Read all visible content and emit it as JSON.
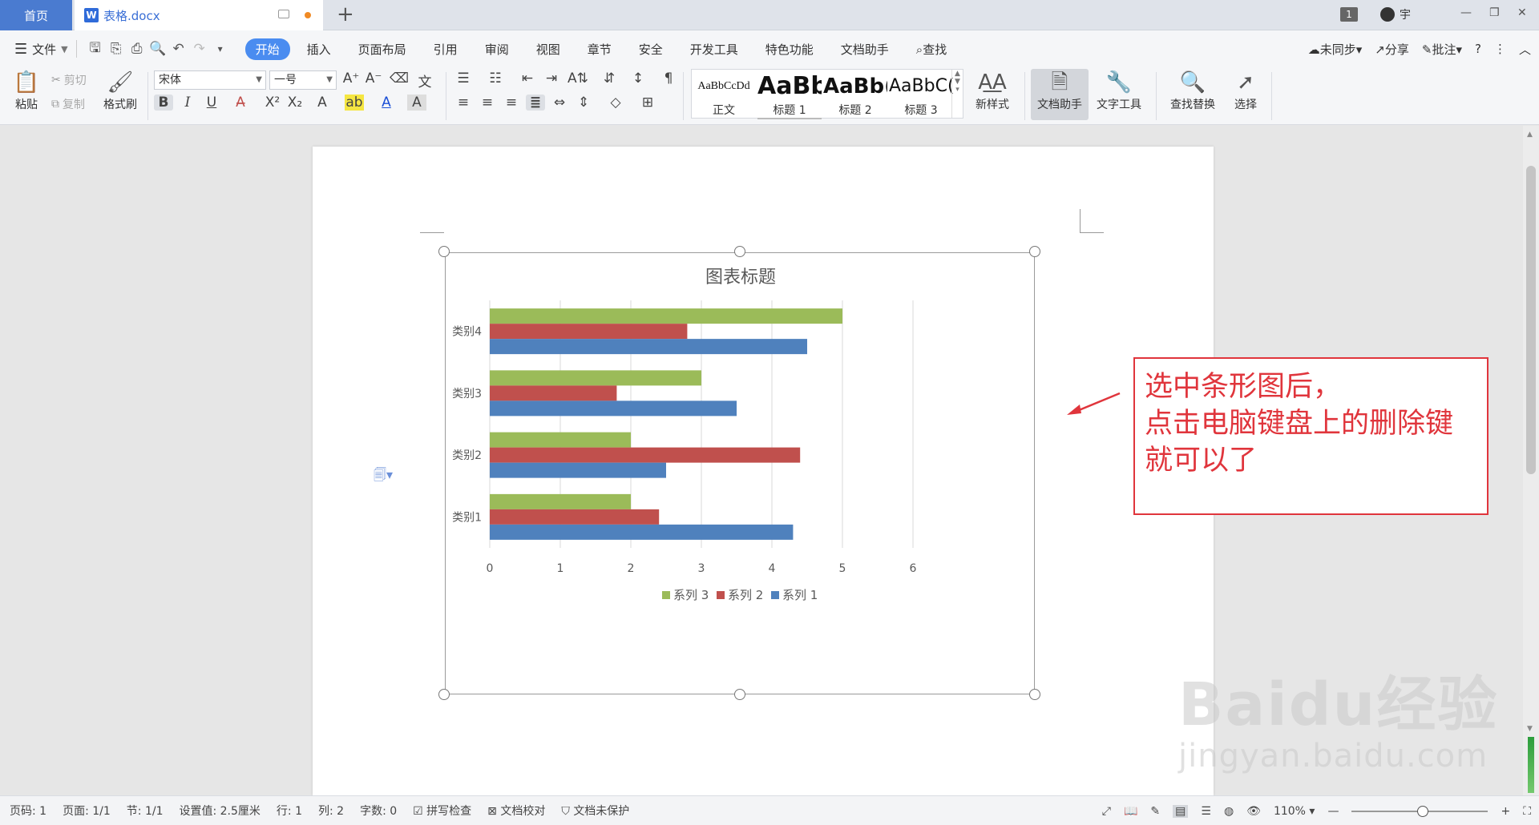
{
  "tabs": {
    "home": "首页",
    "doc_icon": "W",
    "doc_title": "表格.docx",
    "add": "+",
    "badge": "1",
    "user": "宇"
  },
  "menu": {
    "file": "文件",
    "tabs": [
      "开始",
      "插入",
      "页面布局",
      "引用",
      "审阅",
      "视图",
      "章节",
      "安全",
      "开发工具",
      "特色功能",
      "文档助手",
      "查找"
    ],
    "active_tab": "开始",
    "sync": "未同步",
    "share": "分享",
    "comment": "批注"
  },
  "ribbon": {
    "paste": "粘贴",
    "cut": "剪切",
    "copy": "复制",
    "format_painter": "格式刷",
    "font_name": "宋体",
    "font_size": "一号",
    "styles": [
      {
        "sample": "AaBbCcDd",
        "label": "正文"
      },
      {
        "sample": "AaBb",
        "label": "标题 1"
      },
      {
        "sample": "AaBb(",
        "label": "标题 2"
      },
      {
        "sample": "AaBbC(",
        "label": "标题 3"
      }
    ],
    "new_style": "新样式",
    "doc_assistant": "文档助手",
    "text_tools": "文字工具",
    "find_replace": "查找替换",
    "select": "选择"
  },
  "annotation": {
    "lines": [
      "选中条形图后，",
      "点击电脑键盘上的删除键",
      "就可以了"
    ],
    "color": "#e0353c"
  },
  "watermark": {
    "main": "Baidu经验",
    "sub": "jingyan.baidu.com"
  },
  "status": {
    "page": "页码: 1",
    "pages": "页面: 1/1",
    "section": "节: 1/1",
    "setting": "设置值: 2.5厘米",
    "row": "行: 1",
    "col": "列: 2",
    "words": "字数: 0",
    "spell": "拼写检查",
    "proof": "文档校对",
    "protect": "文档未保护",
    "zoom": "110%"
  },
  "chart_data": {
    "type": "bar",
    "orientation": "horizontal",
    "title": "图表标题",
    "categories": [
      "类别1",
      "类别2",
      "类别3",
      "类别4"
    ],
    "series": [
      {
        "name": "系列 1",
        "color": "#4f81bd",
        "values": [
          4.3,
          2.5,
          3.5,
          4.5
        ]
      },
      {
        "name": "系列 2",
        "color": "#c0504d",
        "values": [
          2.4,
          4.4,
          1.8,
          2.8
        ]
      },
      {
        "name": "系列 3",
        "color": "#9bbb59",
        "values": [
          2,
          2,
          3,
          5
        ]
      }
    ],
    "xlim": [
      0,
      6
    ],
    "xticks": [
      "0",
      "1",
      "2",
      "3",
      "4",
      "5",
      "6"
    ],
    "grid": true,
    "legend": "bottom",
    "legend_order": [
      "系列 3",
      "系列 2",
      "系列 1"
    ]
  }
}
